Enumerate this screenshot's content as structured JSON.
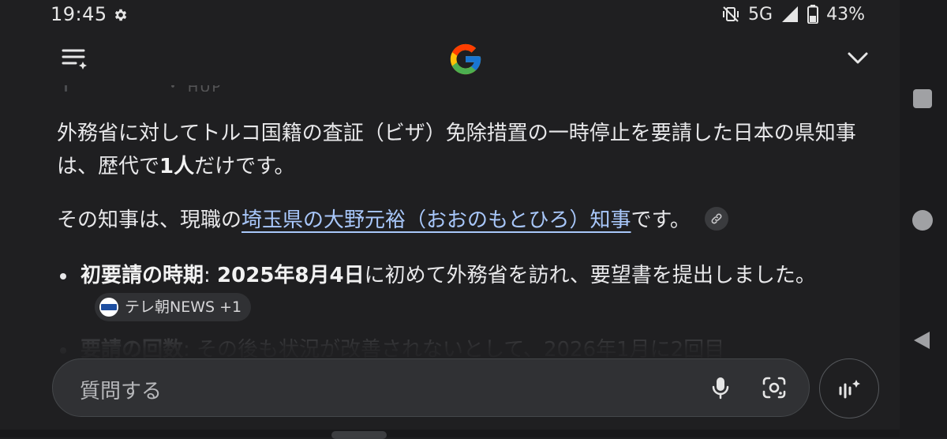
{
  "status_bar": {
    "time": "19:45",
    "network": "5G",
    "battery": "43%",
    "icons": [
      "settings-icon",
      "vibrate-muted-icon",
      "signal-icon",
      "battery-icon"
    ]
  },
  "header": {
    "menu_icon": "history-menu-icon",
    "logo": "google-g-logo",
    "collapse_icon": "chevron-down-icon"
  },
  "answer": {
    "cut_text": "・ HUP",
    "paragraph1": {
      "part1": "外務省に対してトルコ国籍の査証（ビザ）免除措置の一時停止を要請した日本の県知事は、歴代で",
      "bold": "1人",
      "part2": "だけです。"
    },
    "paragraph2": {
      "prefix": "その知事は、現職の",
      "link": "埼玉県の大野元裕（おおのもとひろ）知事",
      "suffix": "です。",
      "link_icon": "link-icon"
    },
    "bullets": [
      {
        "label": "初要請の時期",
        "colon": ": ",
        "bold_value": "2025年8月4日",
        "text": "に初めて外務省を訪れ、要望書を提出しました。",
        "source_label": "テレ朝NEWS +1"
      },
      {
        "label": "要請の回数",
        "colon": ": ",
        "text": "その後も状況が改善されないとして、2026年1月に2回目"
      }
    ]
  },
  "input": {
    "placeholder": "質問する",
    "mic_icon": "mic-icon",
    "lens_icon": "lens-camera-icon",
    "live_icon": "live-sparkle-icon"
  },
  "colors": {
    "background": "#1f1f21",
    "text": "#e8e8ea",
    "link": "#a8c7fa",
    "input_bg": "#303134"
  }
}
